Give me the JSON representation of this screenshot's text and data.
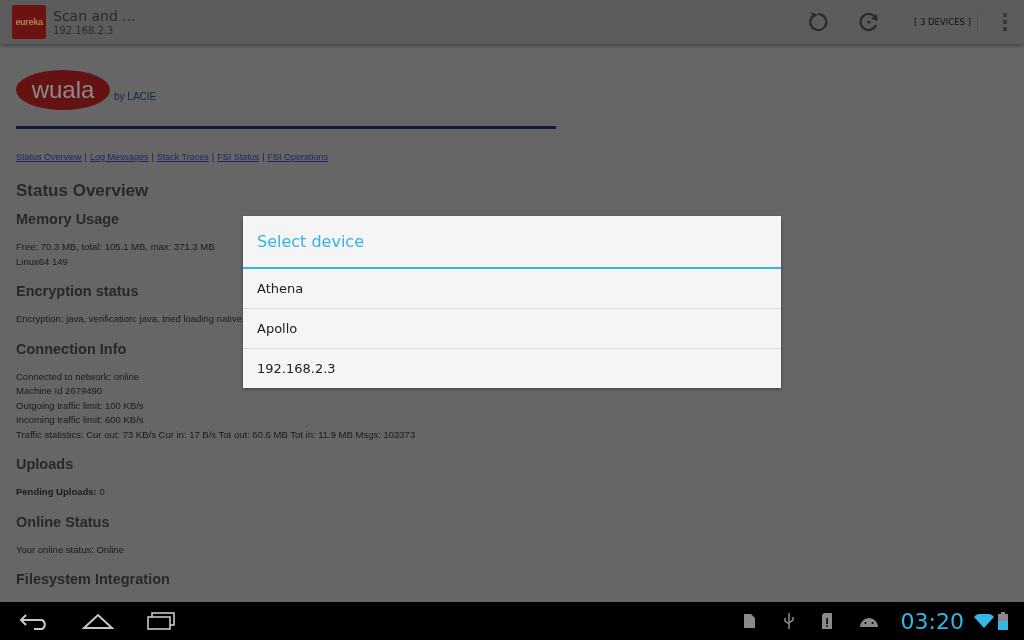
{
  "action_bar": {
    "app_icon_label": "eureka",
    "title": "Scan and ...",
    "subtitle": "192.168.2.3",
    "devices_button": "[ 3 DEVICES ]"
  },
  "page": {
    "logo": {
      "name": "wuala",
      "byline": "by LACIE"
    },
    "link_separator": "|",
    "links": [
      "Status Overview",
      "Log Messages",
      "Stack Traces",
      "FSI Status",
      "FSI Operations"
    ],
    "title": "Status Overview",
    "sections": [
      {
        "heading": "Memory Usage",
        "lines": [
          "Free: 70.3 MB, total: 105.1 MB, max: 371.3 MB",
          "Linux64 149"
        ]
      },
      {
        "heading": "Encryption status",
        "lines": [
          "Encryption: java, verification: java, tried loading native"
        ]
      },
      {
        "heading": "Connection Info",
        "lines": [
          "Connected to network: online",
          "Machine Id 2679490",
          "Outgoing traffic limit: 100 KB/s",
          "Incoming traffic limit: 600 KB/s",
          "Traffic statistics: Cur out: 73 KB/s Cur in: 17 B/s Tot out: 60.6 MB Tot in: 11.9 MB Msgs: 103373"
        ]
      },
      {
        "heading": "Uploads",
        "lines": [
          "**Pending Uploads:** 0"
        ]
      },
      {
        "heading": "Online Status",
        "lines": [
          "Your online status: Online"
        ]
      },
      {
        "heading": "Filesystem Integration"
      }
    ]
  },
  "dialog": {
    "title": "Select device",
    "items": [
      {
        "label": "Athena"
      },
      {
        "label": "Apollo"
      },
      {
        "label": "192.168.2.3"
      }
    ]
  },
  "status_bar": {
    "time": "03:20"
  }
}
